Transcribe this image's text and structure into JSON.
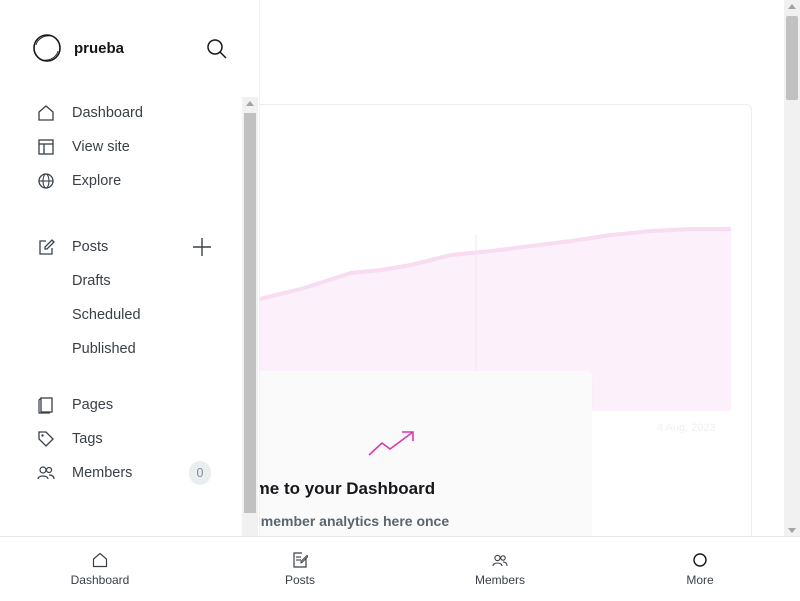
{
  "sidebar": {
    "site_name": "prueba",
    "nav": [
      {
        "label": "Dashboard",
        "icon": "home-icon"
      },
      {
        "label": "View site",
        "icon": "layout-icon"
      },
      {
        "label": "Explore",
        "icon": "globe-icon"
      }
    ],
    "posts": {
      "label": "Posts",
      "icon": "edit-icon",
      "sub_items": [
        "Drafts",
        "Scheduled",
        "Published"
      ]
    },
    "content": [
      {
        "label": "Pages",
        "icon": "page-icon"
      },
      {
        "label": "Tags",
        "icon": "tag-icon"
      },
      {
        "label": "Members",
        "icon": "members-icon",
        "badge": "0"
      }
    ]
  },
  "main": {
    "welcome_title": "Welcome to your Dashboard",
    "welcome_sub": "You'll find member analytics here once",
    "chart_date_label": "4 Aug, 2023",
    "accent": "#d63ab4"
  },
  "bottom_nav": [
    {
      "label": "Dashboard",
      "icon": "home-icon"
    },
    {
      "label": "Posts",
      "icon": "posts-icon"
    },
    {
      "label": "Members",
      "icon": "members-icon"
    },
    {
      "label": "More",
      "icon": "circle-icon"
    }
  ]
}
